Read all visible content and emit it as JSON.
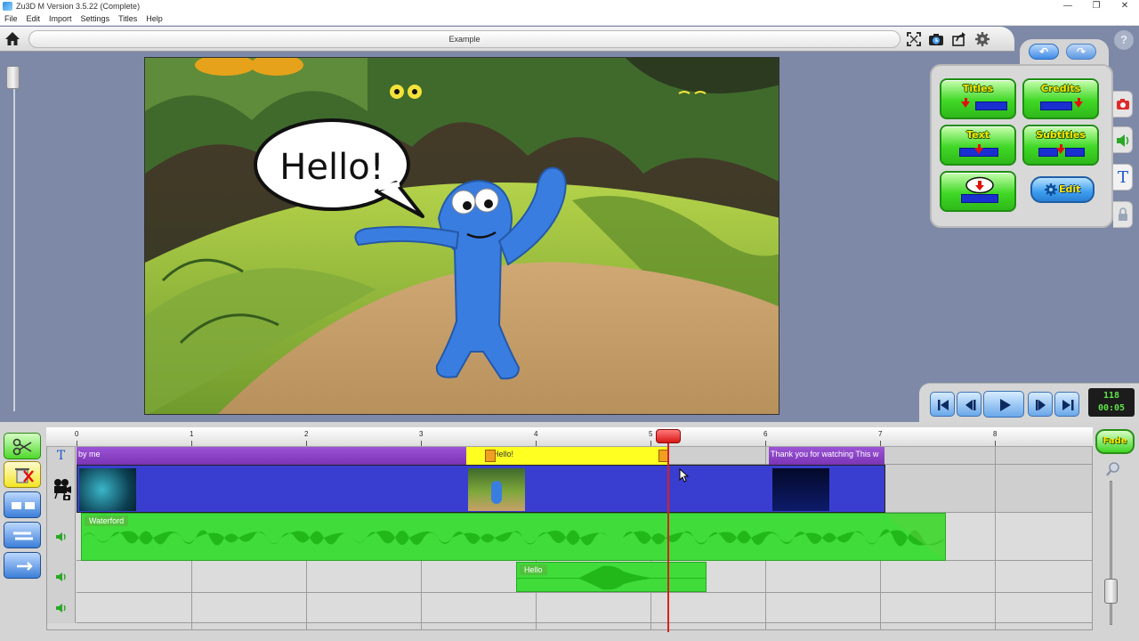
{
  "window": {
    "title": "Zu3D M Version 3.5.22 (Complete)",
    "controls": [
      "—",
      "❐",
      "✕"
    ]
  },
  "menu": [
    "File",
    "Edit",
    "Import",
    "Settings",
    "Titles",
    "Help"
  ],
  "toolbar": {
    "project_title": "Example",
    "icons": [
      "home-icon",
      "fullscreen-icon",
      "camera-timer-icon",
      "export-icon",
      "settings-gear-icon",
      "help-icon"
    ],
    "help_label": "?"
  },
  "preview": {
    "speech_bubble_text": "Hello!"
  },
  "titles_panel": {
    "buttons": [
      {
        "label": "Titles"
      },
      {
        "label": "Credits"
      },
      {
        "label": "Text"
      },
      {
        "label": "Subtitles"
      },
      {
        "label": ""
      },
      {
        "label": "Edit"
      }
    ],
    "side_tabs": [
      "camera-icon",
      "speaker-icon",
      "text-tool-icon",
      "lock-icon"
    ],
    "side_tab_text": "T"
  },
  "transport": {
    "frame": "118",
    "time": "00:05"
  },
  "timeline": {
    "ruler_labels": [
      "0",
      "1",
      "2",
      "3",
      "4",
      "5",
      "6",
      "7",
      "8"
    ],
    "tracks": {
      "titles": {
        "icon_text": "T",
        "clips": [
          {
            "label": "by me",
            "color": "#8a3fc8"
          },
          {
            "label": "Hello!",
            "color": "#ffff22"
          },
          {
            "label": "Thank you for watching  This w",
            "color": "#8a3fc8"
          }
        ]
      },
      "video": {
        "clips": 1
      },
      "audio1": {
        "clip_label": "Waterford"
      },
      "audio2": {
        "clip_label": "Hello"
      },
      "audio3": {
        "clip_label": ""
      }
    },
    "fade_label": "Fade",
    "playhead_position_s": 5.15
  },
  "colors": {
    "accent_green": "#3fdc3a",
    "title_purple": "#8a3fc8",
    "video_blue": "#3a3ed0",
    "playhead_red": "#d82020"
  }
}
